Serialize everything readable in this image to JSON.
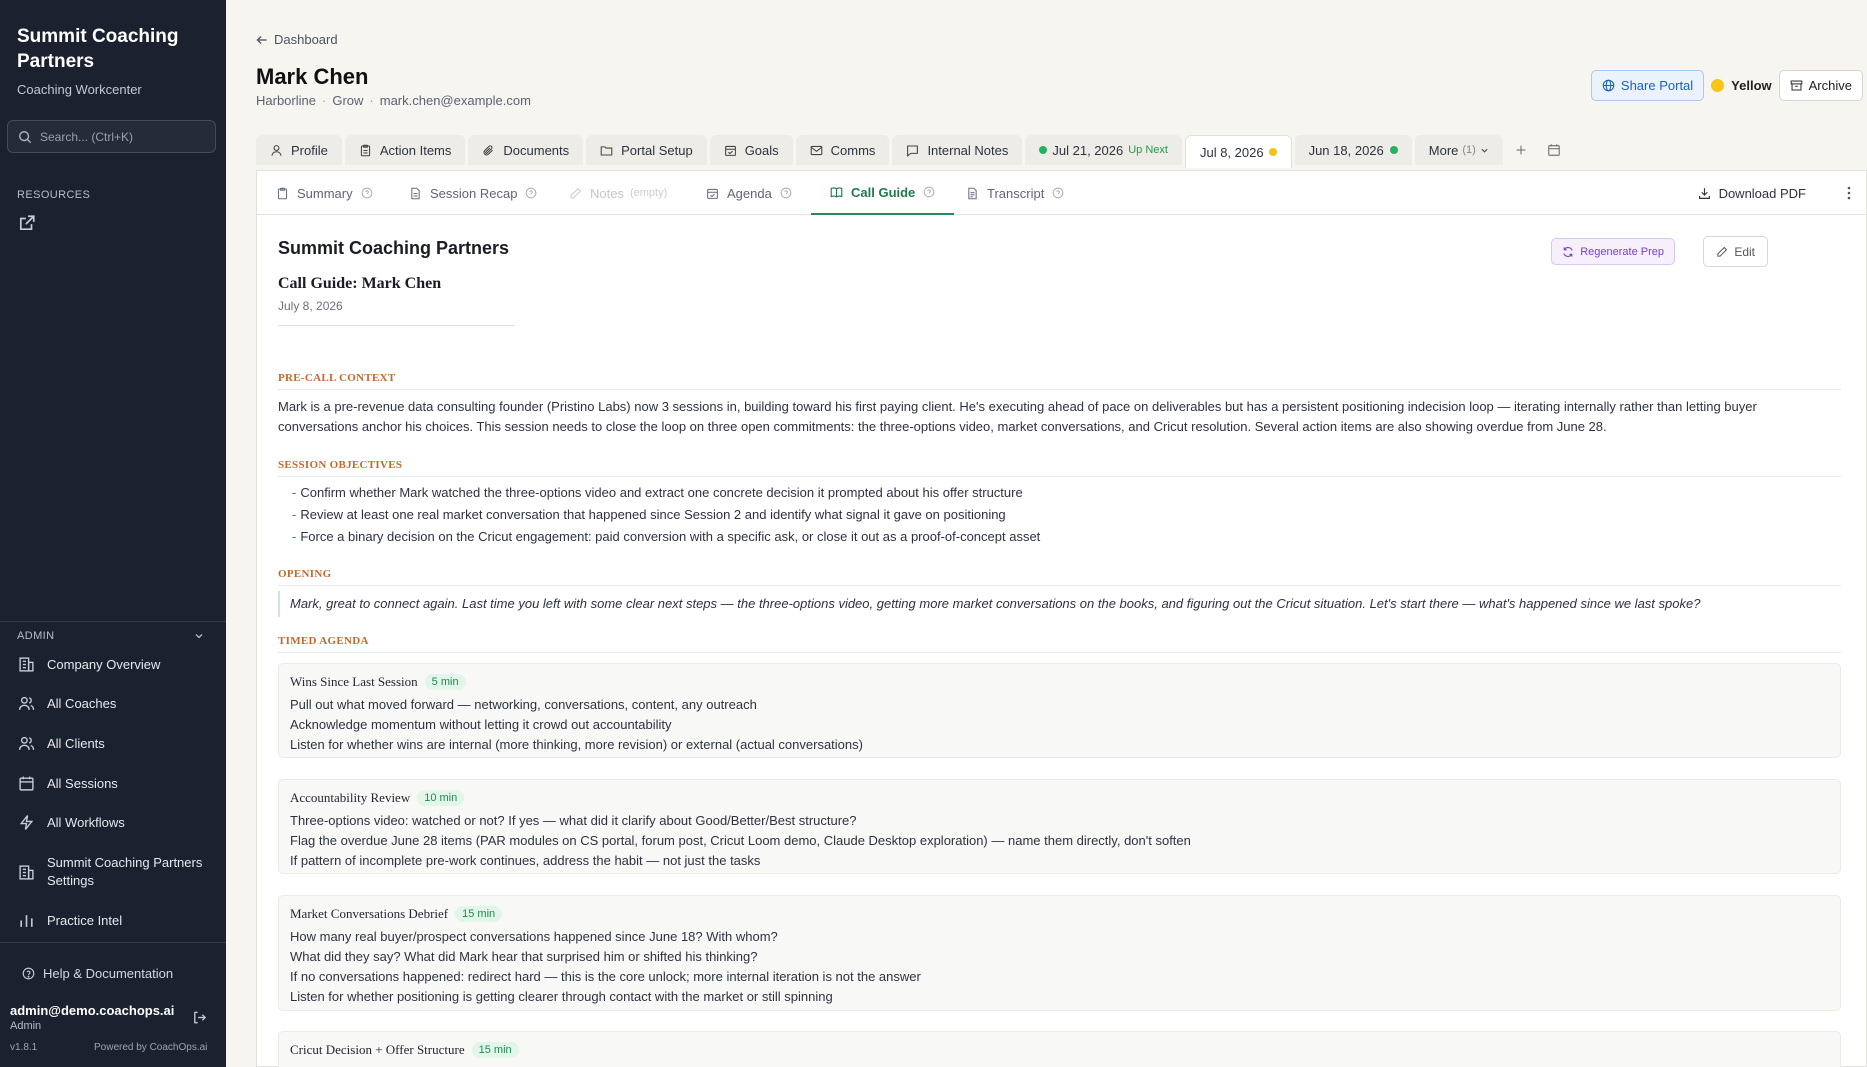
{
  "sidebar": {
    "brand_title": "Summit Coaching Partners",
    "brand_sub": "Coaching Workcenter",
    "search_placeholder": "Search... (Ctrl+K)",
    "resources_label": "RESOURCES",
    "admin_label": "ADMIN",
    "admin_items": [
      {
        "label": "Company Overview",
        "icon": "building-icon"
      },
      {
        "label": "All Coaches",
        "icon": "users-icon"
      },
      {
        "label": "All Clients",
        "icon": "users-icon"
      },
      {
        "label": "All Sessions",
        "icon": "calendar-icon"
      },
      {
        "label": "All Workflows",
        "icon": "lightning-icon"
      },
      {
        "label": "Summit Coaching Partners Settings",
        "icon": "building-icon"
      },
      {
        "label": "Practice Intel",
        "icon": "bar-chart-icon"
      }
    ],
    "help_label": "Help & Documentation",
    "user_email": "admin@demo.coachops.ai",
    "user_role": "Admin",
    "version": "v1.8.1",
    "powered_by": "Powered by CoachOps.ai"
  },
  "header": {
    "back_label": "Dashboard",
    "client_name": "Mark Chen",
    "company": "Harborline",
    "stage": "Grow",
    "email": "mark.chen@example.com",
    "share_label": "Share Portal",
    "status_label": "Yellow",
    "status_color": "#f5c518",
    "archive_label": "Archive"
  },
  "tabs": [
    {
      "label": "Profile",
      "icon": "person-icon"
    },
    {
      "label": "Action Items",
      "icon": "clipboard-icon"
    },
    {
      "label": "Documents",
      "icon": "paperclip-icon"
    },
    {
      "label": "Portal Setup",
      "icon": "folder-icon"
    },
    {
      "label": "Goals",
      "icon": "calendar-check-icon"
    },
    {
      "label": "Comms",
      "icon": "mail-icon"
    },
    {
      "label": "Internal Notes",
      "icon": "message-icon"
    }
  ],
  "session_tabs": {
    "next": {
      "label": "Jul 21, 2026",
      "badge": "Up Next"
    },
    "current": {
      "label": "Jul 8, 2026"
    },
    "past": {
      "label": "Jun 18, 2026"
    },
    "more": {
      "label": "More",
      "count": "(1)"
    }
  },
  "subtabs": {
    "summary": "Summary",
    "recap": "Session Recap",
    "notes": "Notes",
    "notes_empty": "(empty)",
    "agenda": "Agenda",
    "call_guide": "Call Guide",
    "transcript": "Transcript",
    "download": "Download PDF"
  },
  "doc": {
    "org": "Summit Coaching Partners",
    "title": "Call Guide: Mark Chen",
    "date": "July 8, 2026",
    "regen_label": "Regenerate Prep",
    "edit_label": "Edit",
    "precall_heading": "PRE-CALL CONTEXT",
    "precall_text": "Mark is a pre-revenue data consulting founder (Pristino Labs) now 3 sessions in, building toward his first paying client. He's executing ahead of pace on deliverables but has a persistent positioning indecision loop — iterating internally rather than letting buyer conversations anchor his choices. This session needs to close the loop on three open commitments: the three-options video, market conversations, and Cricut resolution. Several action items are also showing overdue from June 28.",
    "objectives_heading": "SESSION OBJECTIVES",
    "objectives": [
      "Confirm whether Mark watched the three-options video and extract one concrete decision it prompted about his offer structure",
      "Review at least one real market conversation that happened since Session 2 and identify what signal it gave on positioning",
      "Force a binary decision on the Cricut engagement: paid conversion with a specific ask, or close it out as a proof-of-concept asset"
    ],
    "opening_heading": "OPENING",
    "opening_text": "Mark, great to connect again. Last time you left with some clear next steps — the three-options video, getting more market conversations on the books, and figuring out the Cricut situation. Let's start there — what's happened since we last spoke?",
    "agenda_heading": "TIMED AGENDA",
    "agenda": [
      {
        "title": "Wins Since Last Session",
        "minutes": "5 min",
        "lines": [
          "Pull out what moved forward — networking, conversations, content, any outreach",
          "Acknowledge momentum without letting it crowd out accountability",
          "Listen for whether wins are internal (more thinking, more revision) or external (actual conversations)"
        ]
      },
      {
        "title": "Accountability Review",
        "minutes": "10 min",
        "lines": [
          "Three-options video: watched or not? If yes — what did it clarify about Good/Better/Best structure?",
          "Flag the overdue June 28 items (PAR modules on CS portal, forum post, Cricut Loom demo, Claude Desktop exploration) — name them directly, don't soften",
          "If pattern of incomplete pre-work continues, address the habit — not just the tasks"
        ]
      },
      {
        "title": "Market Conversations Debrief",
        "minutes": "15 min",
        "lines": [
          "How many real buyer/prospect conversations happened since June 18? With whom?",
          "What did they say? What did Mark hear that surprised him or shifted his thinking?",
          "If no conversations happened: redirect hard — this is the core unlock; more internal iteration is not the answer",
          "Listen for whether positioning is getting clearer through contact with the market or still spinning"
        ]
      },
      {
        "title": "Cricut Decision + Offer Structure",
        "minutes": "15 min",
        "lines": []
      }
    ]
  }
}
